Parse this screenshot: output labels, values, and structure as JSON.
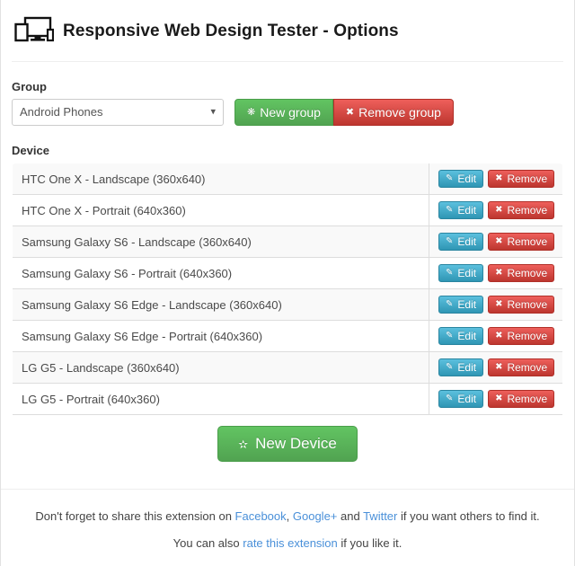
{
  "header": {
    "icon": "responsive-devices-icon",
    "title": "Responsive Web Design Tester - Options"
  },
  "group_section": {
    "label": "Group",
    "select": {
      "value": "Android Phones",
      "chevron_icon": "chevron-down-icon"
    },
    "new_group_button": {
      "label": "New group",
      "icon": "plus-circle-icon"
    },
    "remove_group_button": {
      "label": "Remove group",
      "icon": "times-icon"
    }
  },
  "device_section": {
    "label": "Device",
    "row_buttons": {
      "edit_label": "Edit",
      "edit_icon": "pencil-icon",
      "remove_label": "Remove",
      "remove_icon": "times-icon"
    },
    "rows": [
      {
        "name": "HTC One X - Landscape (360x640)"
      },
      {
        "name": "HTC One X - Portrait (640x360)"
      },
      {
        "name": "Samsung Galaxy S6 - Landscape (360x640)"
      },
      {
        "name": "Samsung Galaxy S6 - Portrait (640x360)"
      },
      {
        "name": "Samsung Galaxy S6 Edge - Landscape (360x640)"
      },
      {
        "name": "Samsung Galaxy S6 Edge - Portrait (640x360)"
      },
      {
        "name": "LG G5 - Landscape (360x640)"
      },
      {
        "name": "LG G5 - Portrait (640x360)"
      }
    ],
    "new_device_button": {
      "label": "New Device",
      "icon": "plus-circle-icon"
    }
  },
  "footer": {
    "line1": {
      "part1": "Don't forget to share this extension on ",
      "link_facebook": "Facebook",
      "sep1": ", ",
      "link_googleplus": "Google+",
      "sep2": " and ",
      "link_twitter": "Twitter",
      "part2": " if you want others to find it."
    },
    "line2": {
      "part1": "You can also ",
      "link_rate": "rate this extension",
      "part2": " if you like it."
    }
  },
  "colors": {
    "success": "#51a351",
    "danger": "#bd362f",
    "info": "#2f96b4",
    "link": "#4a90d9",
    "border": "#dddddd",
    "stripe": "#f9f9f9"
  }
}
